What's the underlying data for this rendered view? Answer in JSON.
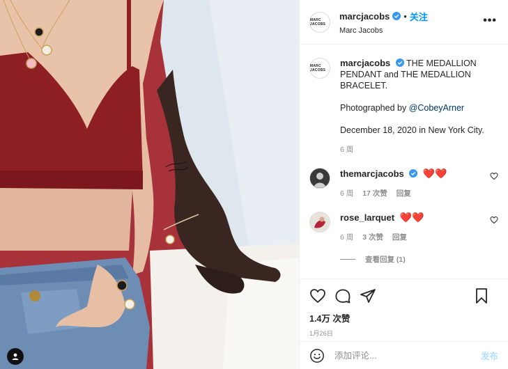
{
  "header": {
    "avatar_text": "MARC JACOBS",
    "username": "marcjacobs",
    "separator": "•",
    "follow_label": "关注",
    "full_name": "Marc Jacobs",
    "more_label": "•••"
  },
  "caption": {
    "username": "marcjacobs",
    "text_1": "THE MEDALLION PENDANT and THE MEDALLION BRACELET.",
    "photographed_prefix": "Photographed by ",
    "mention": "@CobeyArner",
    "date_line": "December 18, 2020 in New York City.",
    "time": "6 周"
  },
  "comments": [
    {
      "username": "themarcjacobs",
      "verified": true,
      "text": "❤️❤️",
      "time": "6 周",
      "likes": "17 次赞",
      "reply": "回复"
    },
    {
      "username": "rose_larquet",
      "verified": false,
      "text": "❤️❤️",
      "time": "6 周",
      "likes": "3 次赞",
      "reply": "回复"
    }
  ],
  "view_replies": "查看回复 (1)",
  "actions": {
    "likes": "1.4万 次赞",
    "date": "1月26日"
  },
  "add_comment": {
    "placeholder": "添加评论...",
    "post_label": "发布"
  },
  "colors": {
    "accent": "#0095f6",
    "mention": "#00376b",
    "heart": "#e0203a",
    "muted": "#8e8e8e"
  }
}
